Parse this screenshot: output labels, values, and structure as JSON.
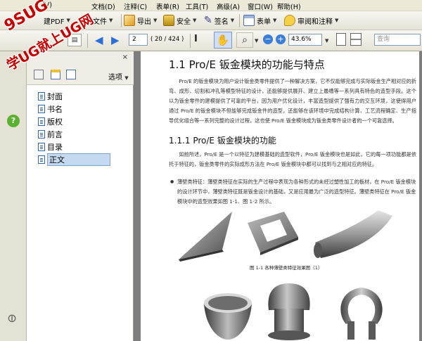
{
  "menubar": {
    "items": [
      "文件(F)",
      "编辑(E)",
      "视图(V)",
      "文档(D)",
      "注释(C)",
      "表单(R)",
      "工具(T)",
      "高级(A)",
      "窗口(W)",
      "帮助(H)"
    ],
    "visible": [
      "(V)",
      "文档(D)",
      "注释(C)",
      "表单(R)",
      "工具(T)",
      "高级(A)",
      "窗口(W)",
      "帮助(H)"
    ]
  },
  "toolbar1": {
    "create_pdf": "建PDF",
    "combine": "合并文件",
    "export": "导出",
    "secure": "安全",
    "sign": "签名",
    "forms": "表单",
    "review": "审阅和注释"
  },
  "toolbar2": {
    "page_number": "2",
    "page_total": "( 20 / 424 )",
    "zoom": "43.6%",
    "search_placeholder": "查询"
  },
  "bookmarks": {
    "options_label": "选项",
    "items": [
      {
        "label": "封面"
      },
      {
        "label": "书名"
      },
      {
        "label": "版权"
      },
      {
        "label": "前言"
      },
      {
        "label": "目录"
      },
      {
        "label": "正文"
      }
    ]
  },
  "document": {
    "heading1": "1.1    Pro/E 钣金模块的功能与特点",
    "para1": "Pro/E 的钣金模块为用户设计钣金类零件提供了一种解决方案，它不仅能够完成与实际钣金生产相对应的折弯、成形、切割和冲孔等模型特征的设计，还能够提供展开、建立上最槽等一系列具有特色的造型手段。这个以为钣金零件的建模提供了可靠的平台，因为用户优化设计，丰富造型提供了强有力的交互环境，这使得用户通过 Pro/E 的钣金模块不但能够完成钣金件的造型，还能够在该环境中完成结构计算、工艺流程确定、生产指导优化组合等一系列完整的设计过程，这也使 Pro/E 钣金模块成为钣金类零件设计者的一个可靠选择。",
    "heading2": "1.1.1    Pro/E 钣金模块的功能",
    "para2": "如前所述，Pro/E 是一个以特征为建模基础的造型软件，Pro/E 钣金模块也是如此，它的每一项功能都是依托于特征的，钣金类零件的实际成形方法在 Pro/E 钣金模块中都可以找到与之相对应的特征。",
    "bullet1": "薄壁类特征：薄壁类特征在实际的生产过程中表现为各种形式的未经过塑性加工的板材，在 Pro/E 钣金模块的设计环节中，薄壁类特征既是钣金设计的基础，又是应用最为广泛的造型特征。薄壁类特征在 Pro/E 钣金模块中的造型效果如图 1-1、图 1-2 所示。",
    "caption": "图 1-1    各种薄壁类特征效果图（1）"
  },
  "watermark": {
    "line1": "9SUG",
    "line2": "学UG就上UG网"
  }
}
